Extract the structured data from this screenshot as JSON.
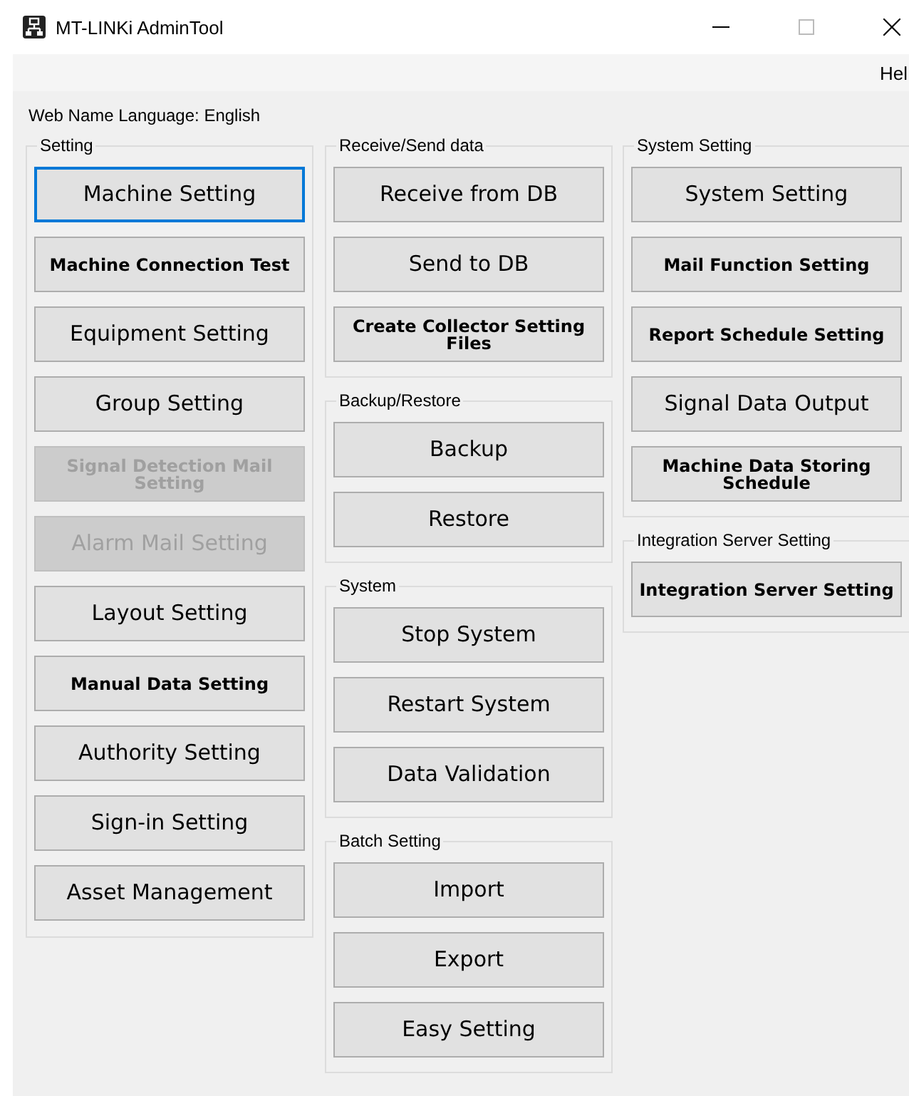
{
  "window": {
    "title": "MT-LINKi AdminTool"
  },
  "menu": [
    "Hel"
  ],
  "language_label": "Web Name Language: English",
  "columns": [
    [
      {
        "title": "Setting",
        "buttons": [
          {
            "label": "Machine Setting",
            "disabled": false,
            "focused": true
          },
          {
            "label": "Machine Connection Test",
            "disabled": false,
            "focused": false
          },
          {
            "label": "Equipment Setting",
            "disabled": false,
            "focused": false
          },
          {
            "label": "Group Setting",
            "disabled": false,
            "focused": false
          },
          {
            "label": "Signal Detection Mail Setting",
            "disabled": true,
            "focused": false
          },
          {
            "label": "Alarm Mail Setting",
            "disabled": true,
            "focused": false
          },
          {
            "label": "Layout Setting",
            "disabled": false,
            "focused": false
          },
          {
            "label": "Manual Data Setting",
            "disabled": false,
            "focused": false
          },
          {
            "label": "Authority Setting",
            "disabled": false,
            "focused": false
          },
          {
            "label": "Sign-in Setting",
            "disabled": false,
            "focused": false
          },
          {
            "label": "Asset Management",
            "disabled": false,
            "focused": false
          }
        ]
      }
    ],
    [
      {
        "title": "Receive/Send data",
        "buttons": [
          {
            "label": "Receive from DB",
            "disabled": false,
            "focused": false
          },
          {
            "label": "Send to DB",
            "disabled": false,
            "focused": false
          },
          {
            "label": "Create Collector Setting Files",
            "disabled": false,
            "focused": false
          }
        ]
      },
      {
        "title": "Backup/Restore",
        "buttons": [
          {
            "label": "Backup",
            "disabled": false,
            "focused": false
          },
          {
            "label": "Restore",
            "disabled": false,
            "focused": false
          }
        ]
      },
      {
        "title": "System",
        "buttons": [
          {
            "label": "Stop System",
            "disabled": false,
            "focused": false
          },
          {
            "label": "Restart System",
            "disabled": false,
            "focused": false
          },
          {
            "label": "Data Validation",
            "disabled": false,
            "focused": false
          }
        ]
      },
      {
        "title": "Batch Setting",
        "buttons": [
          {
            "label": "Import",
            "disabled": false,
            "focused": false
          },
          {
            "label": "Export",
            "disabled": false,
            "focused": false
          },
          {
            "label": "Easy Setting",
            "disabled": false,
            "focused": false
          }
        ]
      }
    ],
    [
      {
        "title": "System Setting",
        "buttons": [
          {
            "label": "System Setting",
            "disabled": false,
            "focused": false
          },
          {
            "label": "Mail Function Setting",
            "disabled": false,
            "focused": false
          },
          {
            "label": "Report Schedule Setting",
            "disabled": false,
            "focused": false
          },
          {
            "label": "Signal Data Output",
            "disabled": false,
            "focused": false
          },
          {
            "label": "Machine Data Storing Schedule",
            "disabled": false,
            "focused": false
          }
        ]
      },
      {
        "title": "Integration Server Setting",
        "buttons": [
          {
            "label": "Integration Server Setting",
            "disabled": false,
            "focused": false
          }
        ]
      }
    ]
  ]
}
